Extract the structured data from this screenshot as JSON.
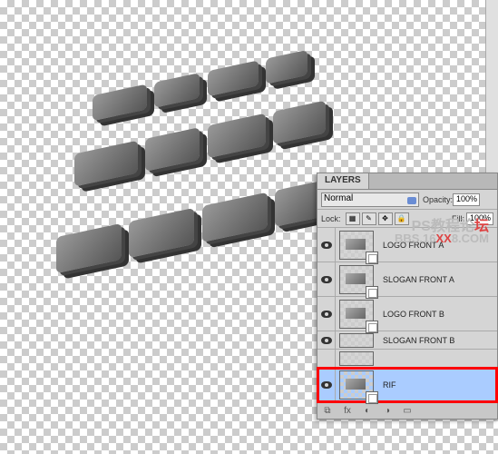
{
  "watermark": {
    "line1a": "PS教程论",
    "line1b": "坛",
    "line2a": "BBS.16",
    "line2b": "XX",
    "line2c": "8.COM"
  },
  "panel": {
    "tab": "LAYERS",
    "blend_mode": "Normal",
    "opacity_label": "Opacity:",
    "opacity_value": "100%",
    "lock_label": "Lock:",
    "fill_label": "Fill:",
    "fill_value": "100%"
  },
  "layers": [
    {
      "name": "LOGO FRONT A",
      "visible": true,
      "selected": false,
      "highlighted": false
    },
    {
      "name": "SLOGAN FRONT A",
      "visible": true,
      "selected": false,
      "highlighted": false
    },
    {
      "name": "LOGO FRONT B",
      "visible": true,
      "selected": false,
      "highlighted": false
    },
    {
      "name": "SLOGAN FRONT B",
      "visible": true,
      "selected": false,
      "highlighted": false
    },
    {
      "name": "RIF",
      "visible": true,
      "selected": true,
      "highlighted": true
    }
  ],
  "lock_icons": [
    "transparency",
    "brush",
    "move",
    "all"
  ],
  "bottom_icons": [
    "link",
    "fx",
    "mask",
    "adjustment",
    "group",
    "new",
    "trash"
  ]
}
